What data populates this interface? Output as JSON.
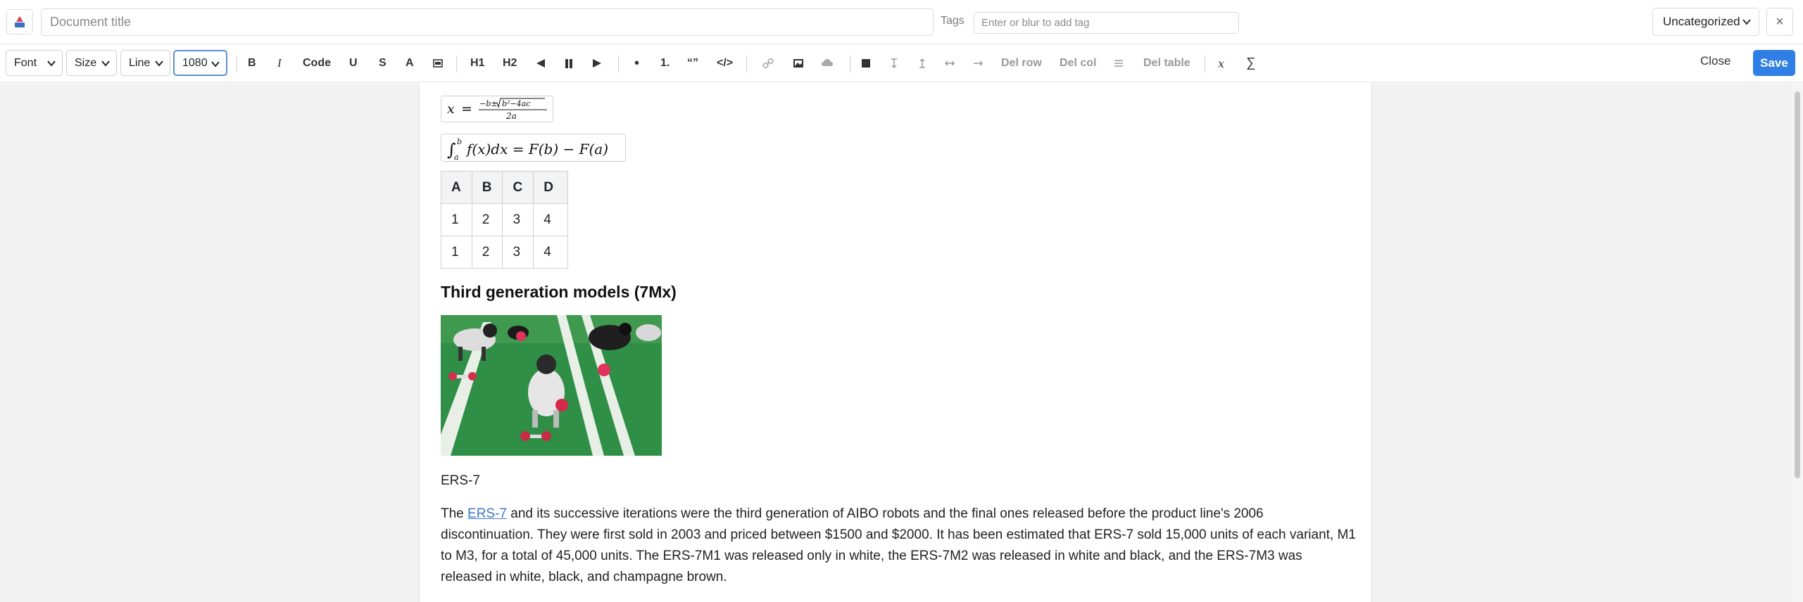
{
  "header": {
    "title_placeholder": "Document title",
    "title_value": "",
    "tags_label": "Tags",
    "tags_placeholder": "Enter or blur to add tag",
    "category": "Uncategorized",
    "close_symbol": "×",
    "brand_icon": "app-logo-icon"
  },
  "toolbar": {
    "font_label": "Font",
    "size_label": "Size",
    "line_label": "Line",
    "width_value": "1080",
    "bold": "B",
    "italic": "I",
    "code": "Code",
    "underline": "U",
    "strike": "S",
    "color": "A",
    "highlight_icon": "highlight-icon",
    "h1": "H1",
    "h2": "H2",
    "align_left_icon": "align-left-icon",
    "align_center_icon": "align-center-icon",
    "align_right_icon": "align-right-icon",
    "bullet": "•",
    "ordered": "1.",
    "quote": "“”",
    "code_block": "</>",
    "link_icon": "link-icon",
    "image_icon": "image-icon",
    "cloud_icon": "cloud-icon",
    "table_icon": "table-icon",
    "add_row_before_icon": "row-insert-above-icon",
    "add_row_after_icon": "row-insert-below-icon",
    "add_col_before_icon": "col-insert-left-icon",
    "add_col_after_icon": "col-insert-right-icon",
    "del_row": "Del row",
    "del_col": "Del col",
    "merge_icon": "merge-cells-icon",
    "del_table": "Del table",
    "inline_math": "x",
    "block_math": "∑",
    "close": "Close",
    "save": "Save",
    "accent": "#2f7fe6"
  },
  "document": {
    "math1": "x = (−b ± √(b²−4ac)) / 2a",
    "math2": "∫ₐᵇ f(x)dx = F(b) − F(a)",
    "table": {
      "headers": [
        "A",
        "B",
        "C",
        "D"
      ],
      "rows": [
        [
          "1",
          "2",
          "3",
          "4"
        ],
        [
          "1",
          "2",
          "3",
          "4"
        ]
      ]
    },
    "heading": "Third generation models (7Mx)",
    "image_caption": "ERS-7",
    "para_prefix": "The ",
    "para_link": "ERS-7",
    "para_rest": " and its successive iterations were the third generation of AIBO robots and the final ones released before the product line's 2006 discontinuation. They were first sold in 2003 and priced between $1500 and $2000. It has been estimated that ERS-7 sold 15,000 units of each variant, M1 to M3, for a total of 45,000 units. The ERS-7M1 was released only in white, the ERS-7M2 was released in white and black, and the ERS-7M3 was released in white, black, and champagne brown."
  }
}
